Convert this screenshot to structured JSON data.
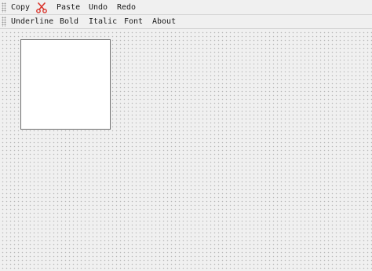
{
  "toolbar_top": {
    "copy_label": "Copy",
    "cut_icon": "scissors-icon",
    "paste_label": "Paste",
    "undo_label": "Undo",
    "redo_label": "Redo"
  },
  "toolbar_bottom": {
    "underline_label": "Underline",
    "bold_label": "Bold",
    "italic_label": "Italic",
    "font_label": "Font",
    "about_label": "About"
  },
  "colors": {
    "cut_icon_color": "#d9342b",
    "background": "#f0f0f0",
    "grid_dot": "#b9b9b9"
  }
}
